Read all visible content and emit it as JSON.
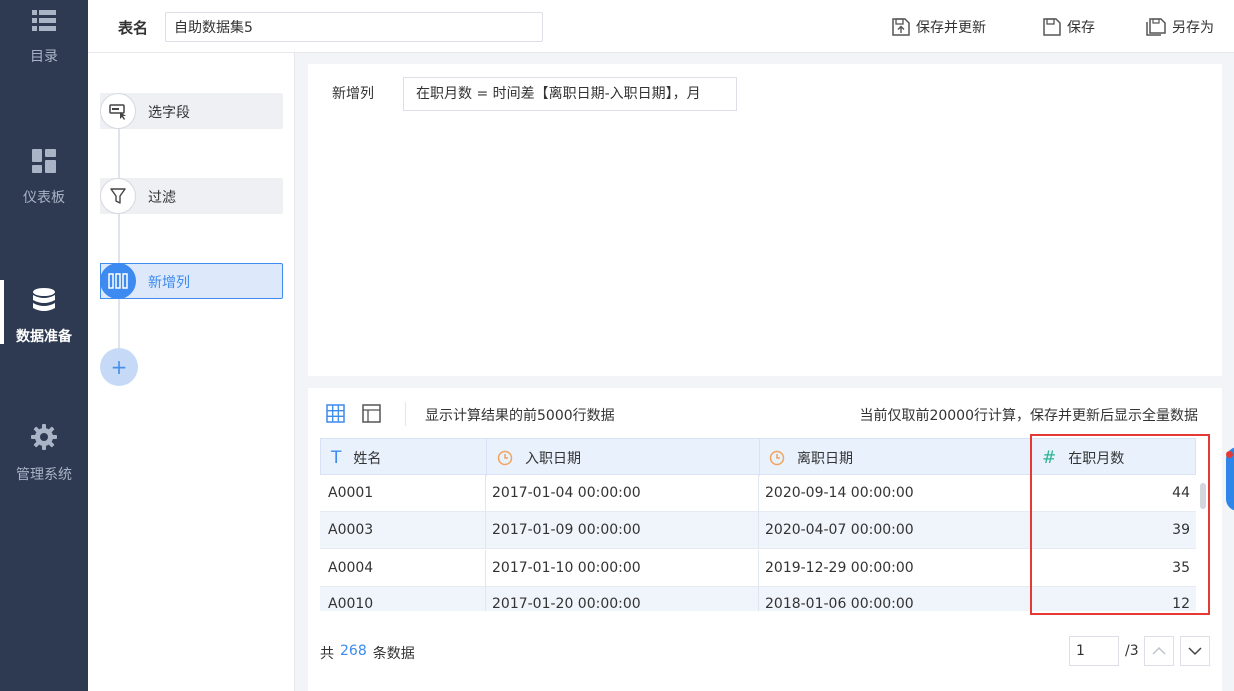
{
  "nav": {
    "items": [
      {
        "label": "目录",
        "icon": "list-icon"
      },
      {
        "label": "仪表板",
        "icon": "dashboard-icon"
      },
      {
        "label": "数据准备",
        "icon": "database-icon",
        "active": true
      },
      {
        "label": "管理系统",
        "icon": "gear-icon"
      }
    ]
  },
  "header": {
    "table_label": "表名",
    "table_name": "自助数据集5",
    "save_update": "保存并更新",
    "save": "保存",
    "save_as": "另存为"
  },
  "steps": {
    "items": [
      {
        "label": "选字段",
        "icon": "select-field-icon"
      },
      {
        "label": "过滤",
        "icon": "filter-icon"
      },
      {
        "label": "新增列",
        "icon": "add-column-icon",
        "active": true
      }
    ],
    "add_label": "+"
  },
  "formula": {
    "label": "新增列",
    "value": "在职月数 = 时间差【离职日期-入职日期】，月"
  },
  "preview": {
    "note_left": "显示计算结果的前5000行数据",
    "note_right": "当前仅取前20000行计算，保存并更新后显示全量数据",
    "columns": [
      {
        "name": "姓名",
        "type_icon": "text-type-icon",
        "type_glyph": "T"
      },
      {
        "name": "入职日期",
        "type_icon": "date-type-icon"
      },
      {
        "name": "离职日期",
        "type_icon": "date-type-icon"
      },
      {
        "name": "在职月数",
        "type_icon": "number-type-icon",
        "type_glyph": "#"
      }
    ],
    "rows": [
      [
        "A0001",
        "2017-01-04 00:00:00",
        "2020-09-14 00:00:00",
        "44"
      ],
      [
        "A0003",
        "2017-01-09 00:00:00",
        "2020-04-07 00:00:00",
        "39"
      ],
      [
        "A0004",
        "2017-01-10 00:00:00",
        "2019-12-29 00:00:00",
        "35"
      ],
      [
        "A0010",
        "2017-01-20 00:00:00",
        "2018-01-06 00:00:00",
        "12"
      ]
    ],
    "total_prefix": "共",
    "total_count": "268",
    "total_suffix": "条数据",
    "page_current": "1",
    "page_total": "/3"
  },
  "colors": {
    "nav_bg": "#2e3a52",
    "accent": "#3d8af0",
    "highlight_border": "#e53935",
    "date_icon": "#f0a35e",
    "number_icon": "#2bb58f"
  }
}
